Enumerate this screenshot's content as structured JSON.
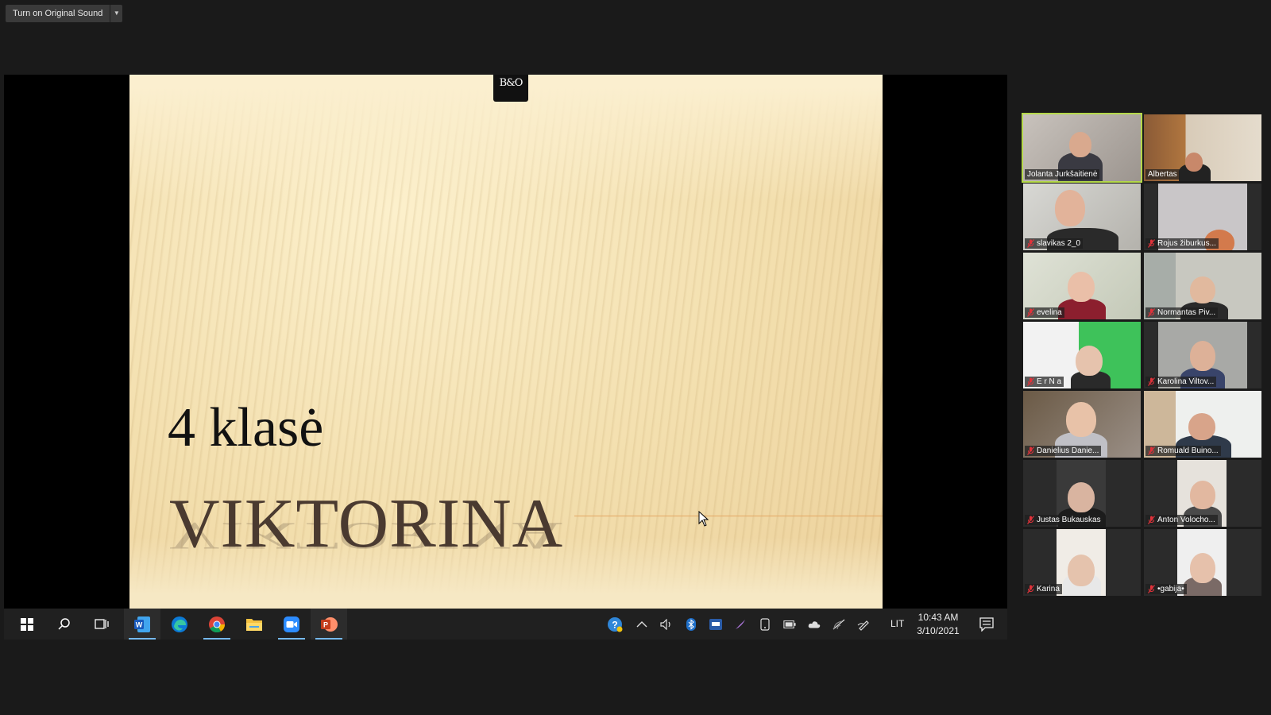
{
  "topbar": {
    "original_sound_label": "Turn on Original Sound"
  },
  "slide": {
    "logo_text": "B&O",
    "subtitle": "4 klasė",
    "title": "VIKTORINA"
  },
  "taskbar": {
    "apps": [
      "start-icon",
      "search-icon",
      "task-view-icon",
      "word-icon",
      "edge-icon",
      "chrome-icon",
      "file-explorer-icon",
      "zoom-icon",
      "powerpoint-icon"
    ],
    "language": "LIT",
    "time": "10:43 AM",
    "date": "3/10/2021"
  },
  "participants": [
    {
      "name": "Jolanta Jurkšaitienė",
      "muted": false,
      "speaking": true
    },
    {
      "name": "Albertas",
      "muted": false,
      "speaking": false
    },
    {
      "name": "slavikas 2_0",
      "muted": true
    },
    {
      "name": "Rojus žiburkus...",
      "muted": true
    },
    {
      "name": "evelina",
      "muted": true
    },
    {
      "name": "Normantas Piv...",
      "muted": true
    },
    {
      "name": "E r N a",
      "muted": true
    },
    {
      "name": "Karolina Viltov...",
      "muted": true
    },
    {
      "name": "Danielius Danie...",
      "muted": true
    },
    {
      "name": "Romuald Buino...",
      "muted": true
    },
    {
      "name": "Justas Bukauskas",
      "muted": true
    },
    {
      "name": "Anton Volocho...",
      "muted": true
    },
    {
      "name": "Karina",
      "muted": true
    },
    {
      "name": "•gabija•",
      "muted": true
    }
  ],
  "colors": {
    "speaking_outline": "#b4d84a",
    "mute_red": "#e0323a",
    "taskbar_accent": "#76b9ed"
  }
}
